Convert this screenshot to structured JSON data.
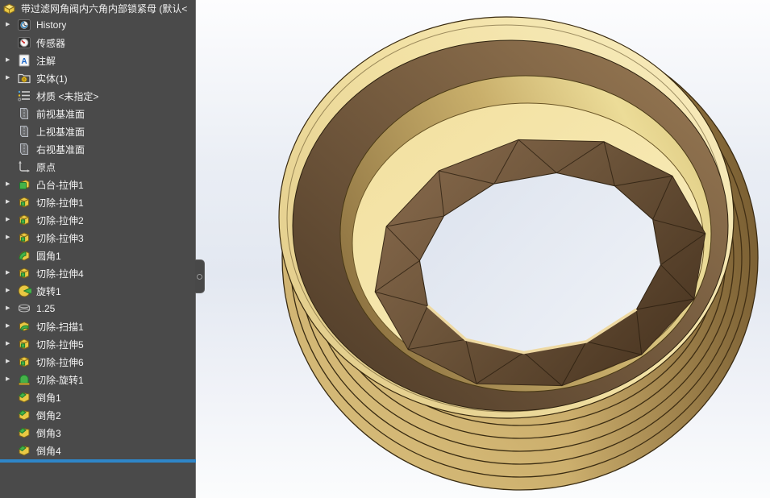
{
  "feature_tree": {
    "root": {
      "label": "带过滤网角阀内六角内部锁紧母 (默认<",
      "icon": "part"
    },
    "items": [
      {
        "label": "History",
        "icon": "history",
        "arrow": true
      },
      {
        "label": "传感器",
        "icon": "sensors",
        "arrow": false
      },
      {
        "label": "注解",
        "icon": "annotations",
        "arrow": true
      },
      {
        "label": "实体(1)",
        "icon": "solids-folder",
        "arrow": true
      },
      {
        "label": "材质 <未指定>",
        "icon": "material",
        "arrow": false
      },
      {
        "label": "前视基准面",
        "icon": "plane",
        "arrow": false
      },
      {
        "label": "上视基准面",
        "icon": "plane",
        "arrow": false
      },
      {
        "label": "右视基准面",
        "icon": "plane",
        "arrow": false
      },
      {
        "label": "原点",
        "icon": "origin",
        "arrow": false
      },
      {
        "label": "凸台-拉伸1",
        "icon": "boss-extrude",
        "arrow": true
      },
      {
        "label": "切除-拉伸1",
        "icon": "cut-extrude",
        "arrow": true
      },
      {
        "label": "切除-拉伸2",
        "icon": "cut-extrude",
        "arrow": true
      },
      {
        "label": "切除-拉伸3",
        "icon": "cut-extrude",
        "arrow": true
      },
      {
        "label": "圆角1",
        "icon": "fillet",
        "arrow": false
      },
      {
        "label": "切除-拉伸4",
        "icon": "cut-extrude",
        "arrow": true
      },
      {
        "label": "旋转1",
        "icon": "revolve",
        "arrow": true
      },
      {
        "label": "1.25",
        "icon": "helix",
        "arrow": true
      },
      {
        "label": "切除-扫描1",
        "icon": "cut-sweep",
        "arrow": true
      },
      {
        "label": "切除-拉伸5",
        "icon": "cut-extrude",
        "arrow": true
      },
      {
        "label": "切除-拉伸6",
        "icon": "cut-extrude",
        "arrow": true
      },
      {
        "label": "切除-旋转1",
        "icon": "cut-revolve",
        "arrow": true
      },
      {
        "label": "倒角1",
        "icon": "chamfer",
        "arrow": false
      },
      {
        "label": "倒角2",
        "icon": "chamfer",
        "arrow": false
      },
      {
        "label": "倒角3",
        "icon": "chamfer",
        "arrow": false
      },
      {
        "label": "倒角4",
        "icon": "chamfer",
        "arrow": false
      }
    ],
    "colors": {
      "panel_background": "#4a4a4a",
      "text": "#f2f2f2",
      "rollback_bar_blue": "#2e86c9"
    }
  },
  "viewport": {
    "colors": {
      "background_top": "#fdfdfe",
      "background_middle": "#e4e9f1",
      "background_bottom": "#fbfcfd",
      "brass_thread": "#c8ab67",
      "brass_rim_cream": "#f2e1a4",
      "counterbore_brown": "#6f563b",
      "gold_step_band": "#d9c071",
      "floor_cream": "#f6e6ac",
      "spline_teeth_brown": "#6b5339"
    }
  }
}
